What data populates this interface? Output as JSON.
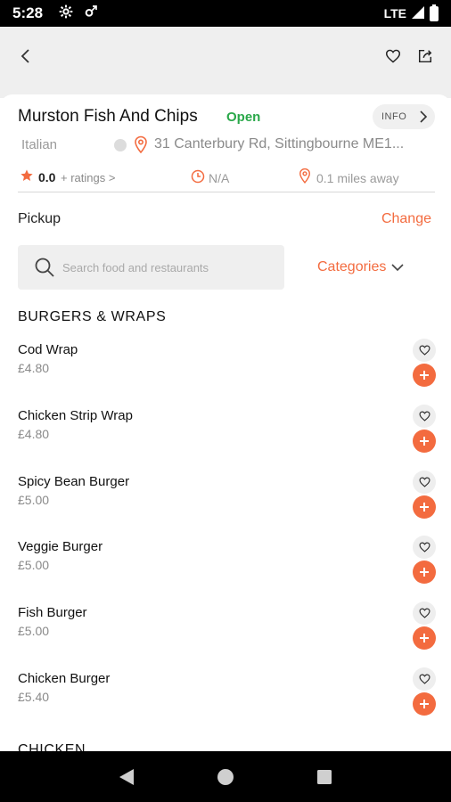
{
  "status_bar": {
    "time": "5:28",
    "network": "LTE"
  },
  "restaurant": {
    "name": "Murston Fish And Chips",
    "status": "Open",
    "info_label": "INFO",
    "cuisine": "Italian",
    "address": "31 Canterbury Rd, Sittingbourne ME1...",
    "rating": "0.0",
    "ratings_label": "+ ratings >",
    "eta": "N/A",
    "distance": "0.1 miles away"
  },
  "order_mode": {
    "label": "Pickup",
    "change_label": "Change"
  },
  "search": {
    "placeholder": "Search food and restaurants",
    "categories_label": "Categories"
  },
  "sections": [
    {
      "title": "BURGERS & WRAPS",
      "items": [
        {
          "name": "Cod Wrap",
          "price": "£4.80"
        },
        {
          "name": "Chicken Strip Wrap",
          "price": "£4.80"
        },
        {
          "name": "Spicy Bean Burger",
          "price": "£5.00"
        },
        {
          "name": "Veggie Burger",
          "price": "£5.00"
        },
        {
          "name": "Fish Burger",
          "price": "£5.00"
        },
        {
          "name": "Chicken Burger",
          "price": "£5.40"
        }
      ]
    },
    {
      "title": "CHICKEN"
    }
  ],
  "colors": {
    "accent": "#f36b3f",
    "open_green": "#2aa84a",
    "header_bg": "#efefef"
  },
  "icons": {
    "back": "chevron-left-icon",
    "favorite": "heart-icon",
    "share": "share-icon",
    "add": "plus-icon",
    "search": "search-icon",
    "location": "pin-icon",
    "time": "clock-icon",
    "rating": "star-icon"
  }
}
